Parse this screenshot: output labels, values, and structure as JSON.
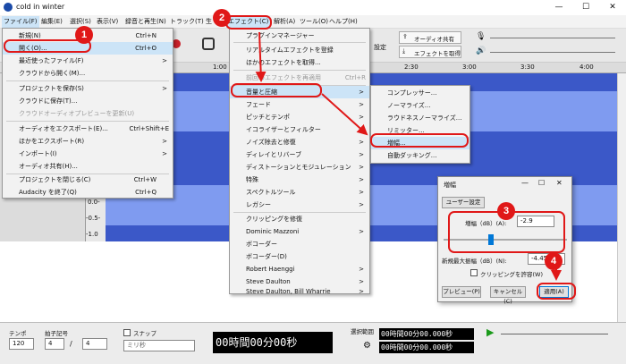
{
  "window": {
    "title": "cold in winter",
    "minimize": "—",
    "maximize": "☐",
    "close": "✕"
  },
  "menubar": {
    "items": [
      "ファイル(F)",
      "編集(E)",
      "選択(S)",
      "表示(V)",
      "録音と再生(N)",
      "トラック(T)",
      "生",
      "エフェクト(C)",
      "解析(A)",
      "ツール(O)",
      "ヘルプ(H)"
    ]
  },
  "toolbar": {
    "audio_settings": "設定",
    "share_audio": "オーディオ共有",
    "get_effects": "エフェクトを取得"
  },
  "ruler": {
    "ticks": [
      "1:00",
      "2:30",
      "3:00",
      "3:30",
      "4:00"
    ]
  },
  "scale": {
    "labels": [
      "0.0-",
      "-0.5-",
      "-1.0"
    ]
  },
  "file_menu": {
    "items": [
      {
        "label": "新規(N)",
        "shortcut": "Ctrl+N"
      },
      {
        "label": "開く(O)...",
        "shortcut": "Ctrl+O"
      },
      {
        "label": "最近使ったファイル(F)",
        "shortcut": "",
        "sub": ">"
      },
      {
        "label": "クラウドから開く(M)...",
        "shortcut": ""
      },
      {
        "label": "プロジェクトを保存(S)",
        "shortcut": "",
        "sub": ">"
      },
      {
        "label": "クラウドに保存(T)...",
        "shortcut": ""
      },
      {
        "label": "クラウドオーディオプレビューを更新(U)",
        "shortcut": ""
      },
      {
        "label": "オーディオをエクスポート(E)...",
        "shortcut": "Ctrl+Shift+E"
      },
      {
        "label": "ほかをエクスポート(R)",
        "shortcut": "",
        "sub": ">"
      },
      {
        "label": "インポート(I)",
        "shortcut": "",
        "sub": ">"
      },
      {
        "label": "オーディオ共有(H)...",
        "shortcut": ""
      },
      {
        "label": "プロジェクトを閉じる(C)",
        "shortcut": "Ctrl+W"
      },
      {
        "label": "Audacity を終了(Q)",
        "shortcut": "Ctrl+Q"
      }
    ]
  },
  "effect_menu": {
    "items": [
      {
        "label": "プラグインマネージャー"
      },
      {
        "label": "リアルタイムエフェクトを登録"
      },
      {
        "label": "ほかのエフェクトを取得..."
      },
      {
        "label": "前回のエフェクトを再適用",
        "shortcut": "Ctrl+R"
      },
      {
        "label": "音量と圧縮",
        "sub": ">"
      },
      {
        "label": "フェード",
        "sub": ">"
      },
      {
        "label": "ピッチとテンポ",
        "sub": ">"
      },
      {
        "label": "イコライザーとフィルター",
        "sub": ">"
      },
      {
        "label": "ノイズ除去と修復",
        "sub": ">"
      },
      {
        "label": "ディレイとリバーブ",
        "sub": ">"
      },
      {
        "label": "ディストーションとモジュレーション",
        "sub": ">"
      },
      {
        "label": "特殊",
        "sub": ">"
      },
      {
        "label": "スペクトルツール",
        "sub": ">"
      },
      {
        "label": "レガシー",
        "sub": ">"
      },
      {
        "label": "クリッピングを修復"
      },
      {
        "label": "Dominic Mazzoni",
        "sub": ">"
      },
      {
        "label": "ボコーダー"
      },
      {
        "label": "ボコーダー(D)"
      },
      {
        "label": "Robert Haenggi",
        "sub": ">"
      },
      {
        "label": "Steve Daulton",
        "sub": ">"
      },
      {
        "label": "Steve Daulton, Bill Wharrie",
        "sub": ">"
      }
    ]
  },
  "volume_menu": {
    "items": [
      "コンプレッサー...",
      "ノーマライズ...",
      "ラウドネスノーマライズ...",
      "リミッター...",
      "増幅...",
      "自動ダッキング..."
    ]
  },
  "amplify_dialog": {
    "title": "増幅",
    "user_preset": "ユーザー設定",
    "amp_label": "増幅（dB）(A):",
    "amp_value": "-2.9",
    "slider_level": 0.38,
    "peak_label": "新規最大振幅（dB）(N):",
    "peak_value": "-4.4539",
    "allow_clipping": "クリッピングを許容(W)",
    "preview": "プレビュー(P)",
    "cancel": "キャンセル(C)",
    "apply": "適用(A)"
  },
  "bottom_bar": {
    "tempo_label": "テンポ",
    "tempo_value": "120",
    "time_sig_label": "拍子記号",
    "time_sig_num": "4",
    "time_sig_den": "4",
    "snap_label": "スナップ",
    "snap_value": "ミリ秒",
    "time_display": "00時間00分00秒",
    "selection_label": "選択範囲",
    "sel_start": "00時間00分00.000秒",
    "sel_end": "00時間00分00.000秒"
  },
  "badges": [
    "1",
    "2",
    "3",
    "4"
  ]
}
